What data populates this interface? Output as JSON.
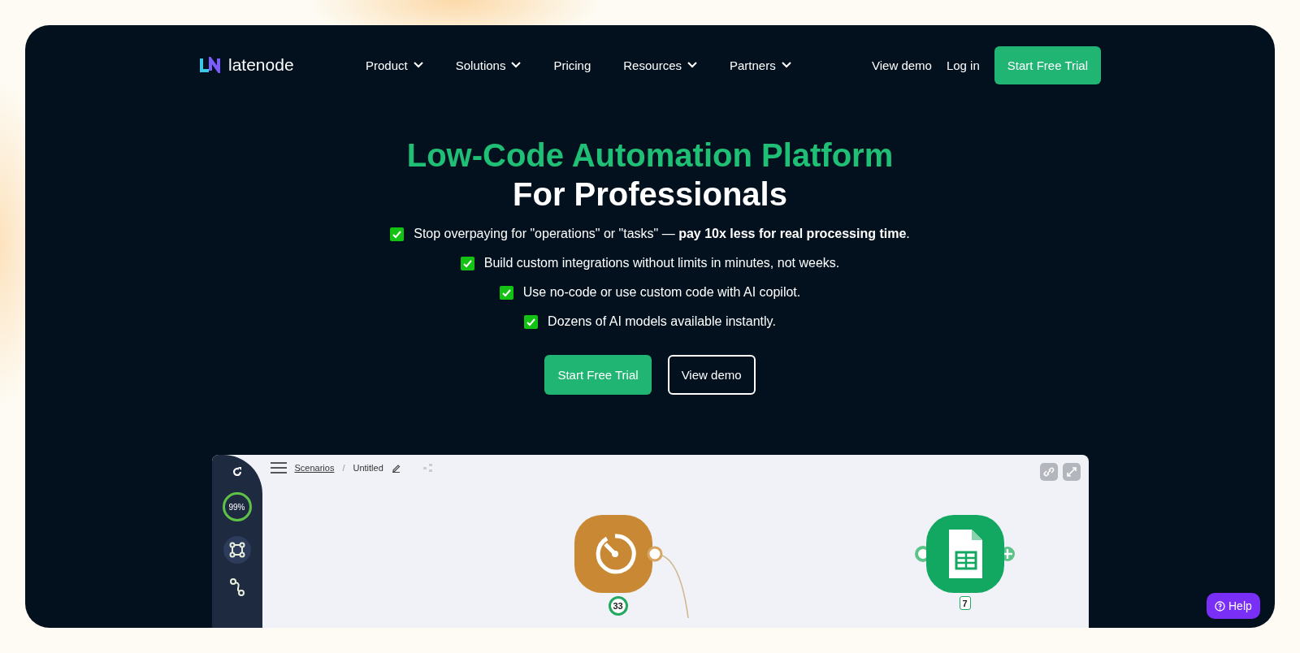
{
  "nav": {
    "logo": "latenode",
    "items": [
      {
        "label": "Product",
        "dropdown": true
      },
      {
        "label": "Solutions",
        "dropdown": true
      },
      {
        "label": "Pricing",
        "dropdown": false
      },
      {
        "label": "Resources",
        "dropdown": true
      },
      {
        "label": "Partners",
        "dropdown": true
      }
    ],
    "actions": [
      {
        "label": "View demo",
        "kind": "link"
      },
      {
        "label": "Log in",
        "kind": "link"
      },
      {
        "label": "Start Free Trial",
        "kind": "primary"
      }
    ]
  },
  "hero": {
    "title": "Low-Code Automation Platform",
    "subtitle": "For Professionals",
    "bullets": [
      "Stop overpaying for \"operations\" or \"tasks\" — **pay 10x less for real processing time**.",
      "Build custom integrations without limits in minutes, not weeks.",
      "Use no-code or use custom code with AI copilot.",
      "Dozens of AI models available instantly."
    ],
    "buttons": [
      {
        "label": "Start Free Trial",
        "kind": "primary"
      },
      {
        "label": "View demo",
        "kind": "outline"
      }
    ]
  },
  "app": {
    "breadcrumb": "Scenarios",
    "separator": "/",
    "scenario": "Untitled",
    "usage": "99%",
    "nodes": [
      {
        "kind": "timer",
        "count": "33"
      },
      {
        "kind": "sheets",
        "count": "7"
      }
    ]
  },
  "help": "Help"
}
